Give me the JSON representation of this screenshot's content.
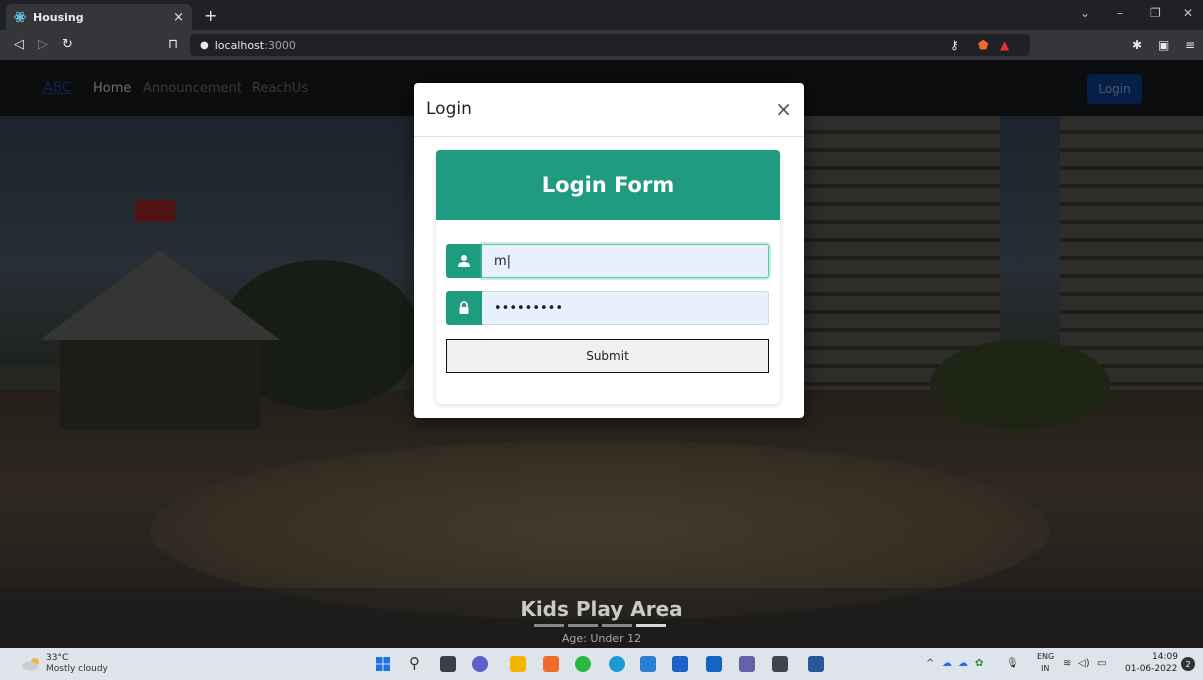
{
  "browser": {
    "tab_title": "Housing",
    "tab_close": "×",
    "new_tab": "+",
    "url_host": "localhost",
    "url_port": ":3000"
  },
  "site": {
    "brand": "ABC",
    "nav": [
      "Home",
      "Announcement",
      "ReachUs"
    ],
    "login_button": "Login",
    "slide_title": "Kids Play Area",
    "slide_subtitle": "Age: Under 12"
  },
  "modal": {
    "title": "Login",
    "close": "×",
    "form_title": "Login Form",
    "username_value": "m|",
    "password_value": "•••••••••",
    "submit_label": "Submit"
  },
  "taskbar": {
    "temperature": "33°C",
    "weather": "Mostly cloudy",
    "lang_line1": "ENG",
    "lang_line2": "IN",
    "time": "14:09",
    "date": "01-06-2022",
    "notifications": "2"
  },
  "colors": {
    "accent": "#1f9c7f",
    "nav_login_bg": "#0a3f8f"
  }
}
